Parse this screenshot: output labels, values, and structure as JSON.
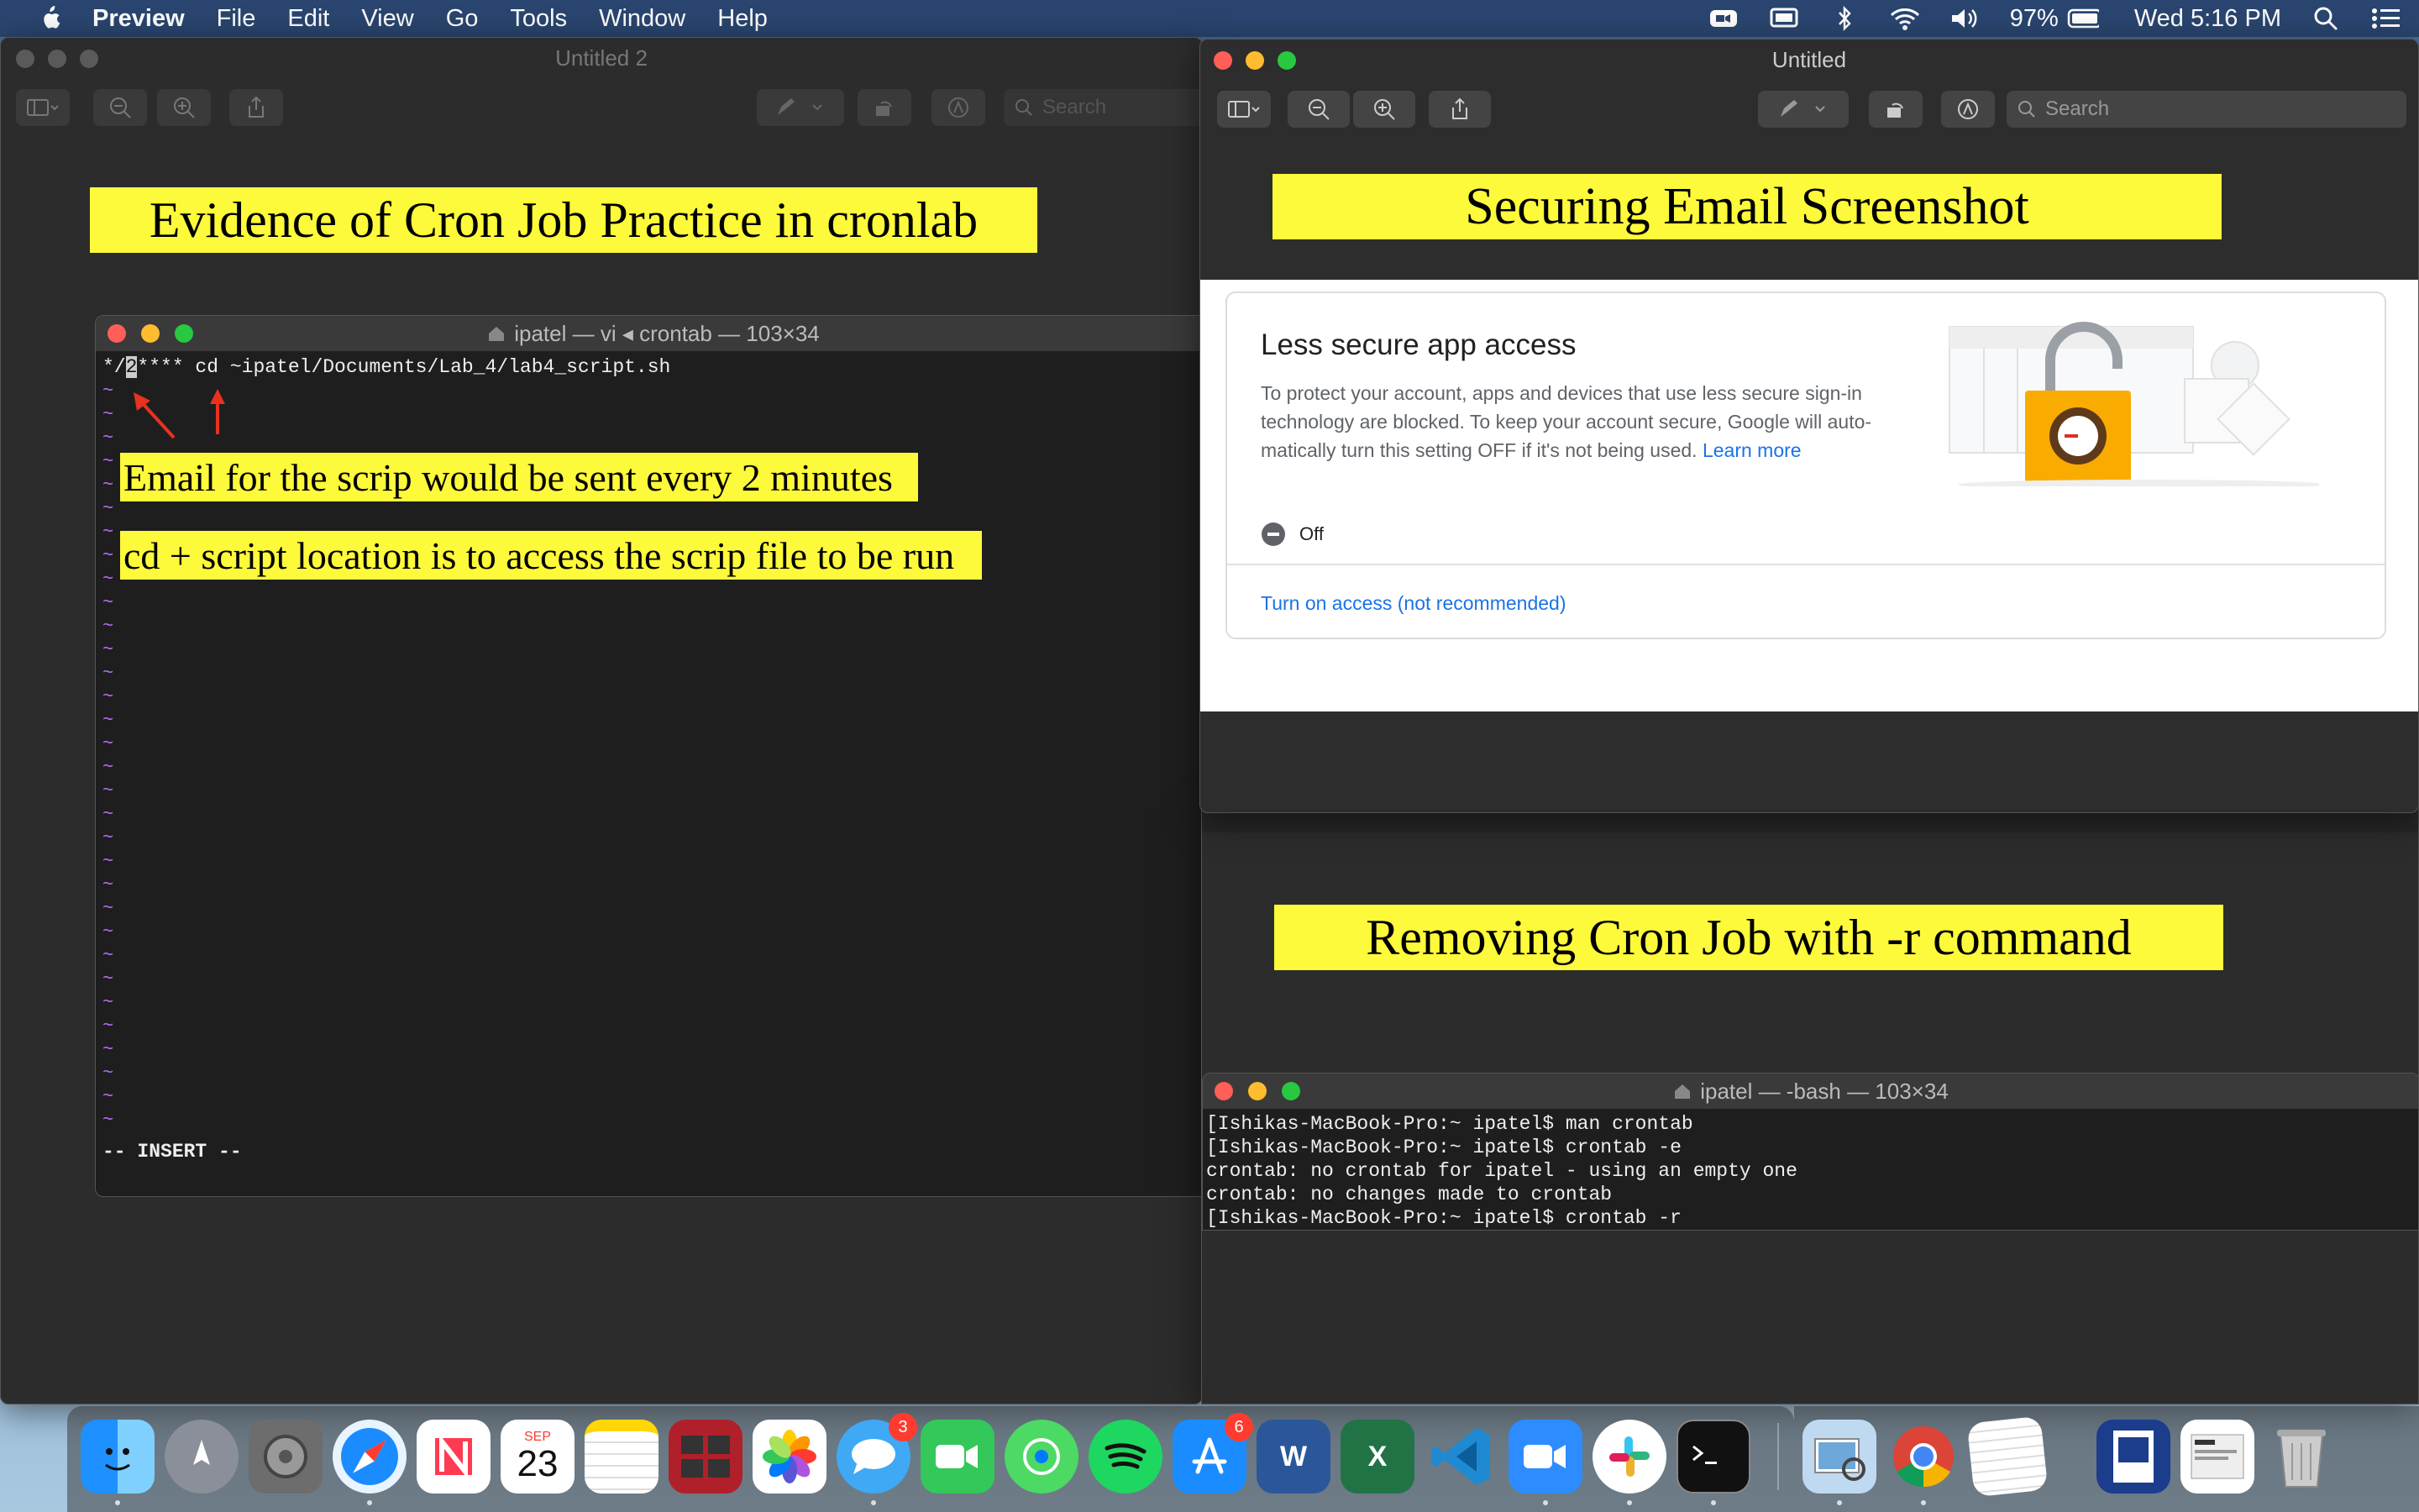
{
  "menubar": {
    "app_name": "Preview",
    "menus": [
      "File",
      "Edit",
      "View",
      "Go",
      "Tools",
      "Window",
      "Help"
    ],
    "battery": "97%",
    "clock": "Wed 5:16 PM"
  },
  "left_window": {
    "title": "Untitled 2",
    "search_placeholder": "Search",
    "banner": "Evidence of Cron Job Practice in cronlab",
    "terminal": {
      "title": "ipatel — vi ◂ crontab — 103×34",
      "line1_prefix": "*/",
      "line1_cursor": "2",
      "line1_rest": "**** cd ~ipatel/Documents/Lab_4/lab4_script.sh",
      "tilde": "~",
      "mode": "-- INSERT --"
    },
    "note1": "Email for the scrip would be sent every 2 minutes",
    "note2": "cd + script location is to access the scrip file to be run"
  },
  "right_window": {
    "title": "Untitled",
    "search_placeholder": "Search",
    "banner_top": "Securing Email Screenshot",
    "card": {
      "heading": "Less secure app access",
      "body": "To protect your account, apps and devices that use less secure sign-in technology are blocked. To keep your account secure, Google will auto-matically turn this setting OFF if it's not being used.",
      "link": "Learn more",
      "status": "Off",
      "action": "Turn on access (not recommended)"
    },
    "banner_bottom": "Removing Cron Job with -r command",
    "terminal": {
      "title": "ipatel — -bash — 103×34",
      "lines": [
        "[Ishikas-MacBook-Pro:~ ipatel$ man crontab",
        "[Ishikas-MacBook-Pro:~ ipatel$ crontab -e",
        "crontab: no crontab for ipatel - using an empty one",
        "crontab: no changes made to crontab",
        "[Ishikas-MacBook-Pro:~ ipatel$ crontab -r"
      ]
    }
  },
  "dock": {
    "calendar_month": "SEP",
    "calendar_day": "23",
    "messages_badge": "3",
    "appstore_badge": "6",
    "word_letter": "W",
    "excel_letter": "X"
  },
  "colors": {
    "banner": "#fdf93b",
    "google_link": "#1a73e8",
    "vi_tilde": "#b86fff",
    "arrow": "#e8321e"
  }
}
